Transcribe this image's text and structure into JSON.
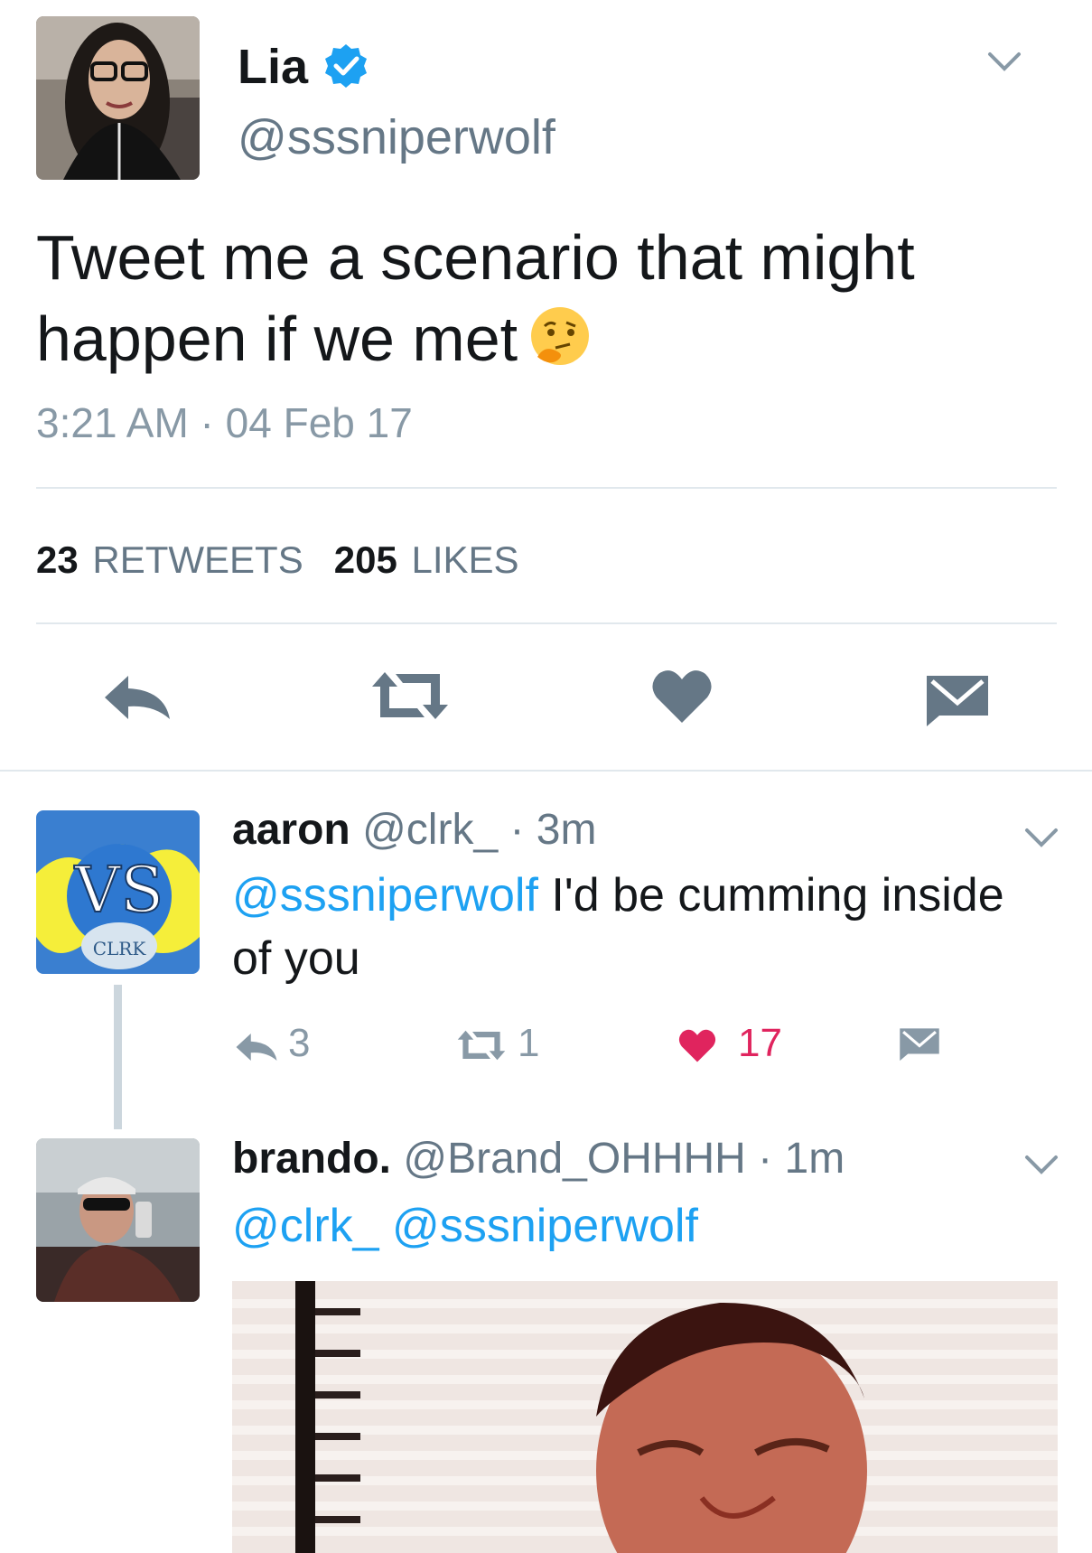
{
  "main_tweet": {
    "name": "Lia",
    "handle": "@sssniperwolf",
    "text": "Tweet me a scenario that might happen if we met",
    "emoji": "thinking-face-emoji",
    "timestamp": "3:21 AM · 04 Feb 17",
    "retweets_count": "23",
    "retweets_label": "RETWEETS",
    "likes_count": "205",
    "likes_label": "LIKES",
    "actions": [
      "reply-icon",
      "retweet-icon",
      "heart-icon",
      "dm-icon"
    ]
  },
  "replies": [
    {
      "name": "aaron",
      "handle": "@clrk_ · 3m",
      "mention": "@sssniperwolf",
      "text_line1": " I'd be cumming inside",
      "text_line2": "of you",
      "replies_count": "3",
      "retweets_count": "1",
      "likes_count": "17",
      "liked": true
    },
    {
      "name": "brando.",
      "handle": "@Brand_OHHHH · 1m",
      "mention1": "@clrk_",
      "mention2": "@sssniperwolf"
    }
  ],
  "colors": {
    "link": "#1da1f2",
    "verified": "#1da1f2",
    "like": "#e0245e",
    "icon": "#657786",
    "divider": "#e1e8ed"
  }
}
